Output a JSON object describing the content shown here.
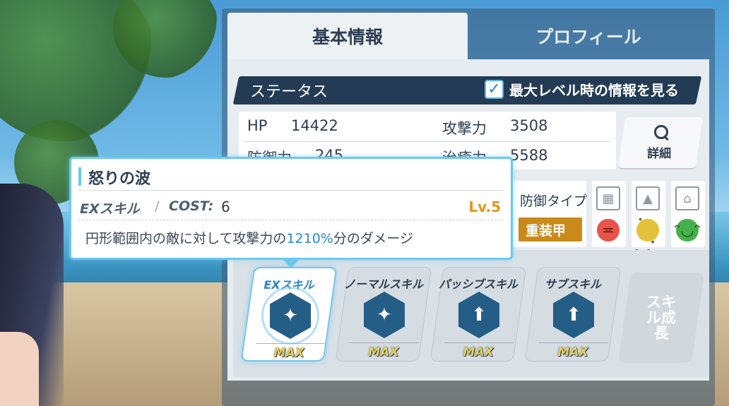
{
  "tabs": {
    "basic": "基本情報",
    "profile": "プロフィール"
  },
  "status": {
    "title": "ステータス",
    "max_level_checkbox": {
      "label": "最大レベル時の情報を見る",
      "checked": true
    }
  },
  "stats": {
    "hp_label": "HP",
    "hp_value": "14422",
    "attack_label": "攻撃力",
    "attack_value": "3508",
    "defense_label": "防御力",
    "defense_value": "245",
    "heal_label": "治癒力",
    "heal_value": "5588"
  },
  "detail_button": {
    "label": "詳細",
    "icon": "search-icon"
  },
  "defense_type": {
    "label": "防御タイプ",
    "value": "重装甲",
    "color": "#c98a1a"
  },
  "terrain": [
    {
      "name": "street",
      "icon": "building-icon",
      "mood": "angry",
      "color": "#e8534a"
    },
    {
      "name": "outdoor",
      "icon": "mountain-icon",
      "mood": "neutral",
      "color": "#e2c23a"
    },
    {
      "name": "indoor",
      "icon": "house-icon",
      "mood": "happy",
      "color": "#46b04a"
    }
  ],
  "skills": [
    {
      "name": "EXスキル",
      "level": "MAX",
      "icon": "slash-icon",
      "active": true
    },
    {
      "name": "ノーマルスキル",
      "level": "MAX",
      "icon": "slash-icon",
      "active": false
    },
    {
      "name": "パッシブスキル",
      "level": "MAX",
      "icon": "pistol-up-icon",
      "active": false
    },
    {
      "name": "サブスキル",
      "level": "MAX",
      "icon": "pistol-up-icon",
      "active": false
    }
  ],
  "grow_button": {
    "label": "スキル成長"
  },
  "tooltip": {
    "title": "怒りの波",
    "type": "EXスキル",
    "separator": "/",
    "cost_label": "COST:",
    "cost_value": "6",
    "level": "Lv.5",
    "desc_prefix": "円形範囲内の敵に対して攻撃力の",
    "desc_highlight": "1210%",
    "desc_suffix": "分のダメージ"
  },
  "colors": {
    "accent": "#6cc8ee",
    "header": "#243b56",
    "level": "#e4961b",
    "highlight": "#2a8ad0"
  }
}
